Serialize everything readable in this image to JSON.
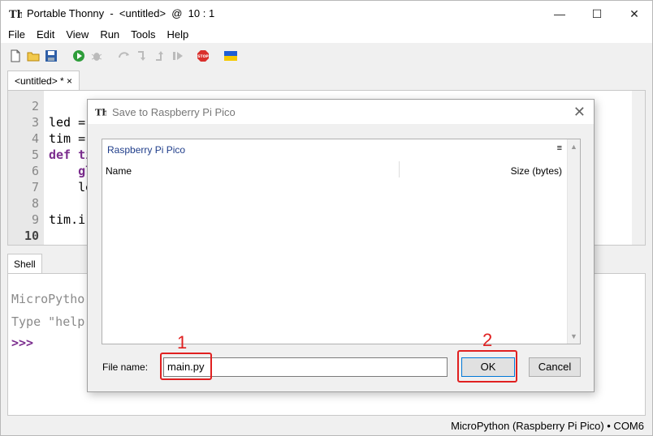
{
  "window": {
    "title": "Portable Thonny  -  <untitled>  @  10 : 1",
    "minimize": "—",
    "maximize": "☐",
    "close": "✕"
  },
  "menu": [
    "File",
    "Edit",
    "View",
    "Run",
    "Tools",
    "Help"
  ],
  "editor": {
    "tab_label": "<untitled>  *  ×",
    "line_numbers": [
      "2",
      "3",
      "4",
      "5",
      "6",
      "7",
      "8",
      "9",
      "10"
    ],
    "code_lines": [
      {
        "text": "",
        "kw": false
      },
      {
        "text": "led =",
        "kw": false
      },
      {
        "text": "tim =",
        "kw": false
      },
      {
        "text": "def ti",
        "kw": true
      },
      {
        "text": "    gl",
        "kw": true
      },
      {
        "text": "    le",
        "kw": false
      },
      {
        "text": "",
        "kw": false
      },
      {
        "text": "tim.i",
        "kw": false
      },
      {
        "text": "",
        "kw": false
      }
    ]
  },
  "shell": {
    "tab_label": "Shell",
    "line1": "MicroPytho",
    "line2": "Type \"help",
    "prompt": ">>>"
  },
  "status": "MicroPython (Raspberry Pi Pico)  •  COM6",
  "dialog": {
    "title": "Save to Raspberry Pi Pico",
    "close": "✕",
    "location": "Raspberry Pi Pico",
    "menu_icon": "≡",
    "col_name": "Name",
    "col_size": "Size (bytes)",
    "filename_label": "File name:",
    "filename_value": "main.py",
    "ok_label": "OK",
    "cancel_label": "Cancel"
  },
  "annotations": {
    "step1": "1",
    "step2": "2",
    "color": "#e02020"
  },
  "icons": [
    "new-file-icon",
    "open-folder-icon",
    "save-icon",
    "run-icon",
    "debug-icon",
    "step-over-icon",
    "step-into-icon",
    "step-out-icon",
    "resume-icon",
    "stop-icon",
    "ukraine-flag-icon"
  ]
}
